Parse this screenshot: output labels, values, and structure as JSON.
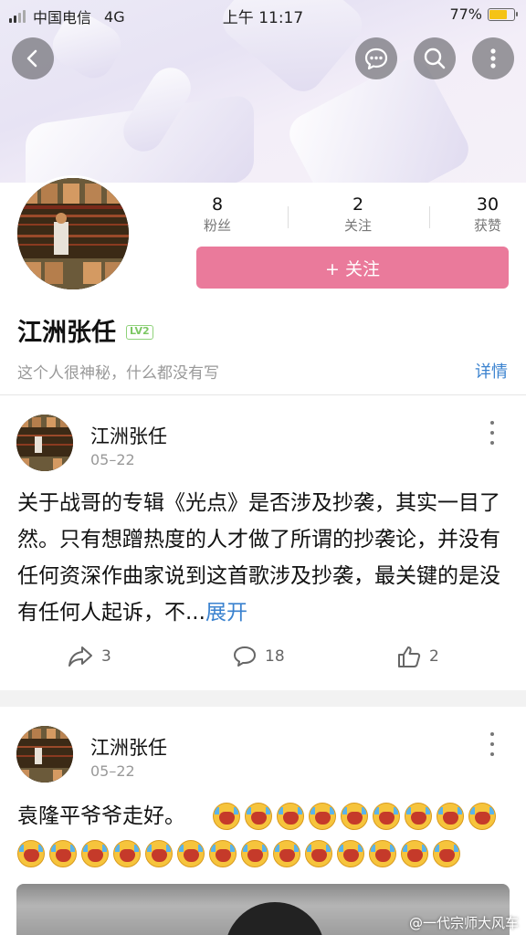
{
  "status_bar": {
    "carrier": "中国电信",
    "network": "4G",
    "time": "上午 11:17",
    "battery_text": "77%",
    "battery_level": 0.77
  },
  "header": {
    "back_icon": "chevron-left-icon",
    "chat_icon": "chat-bubble-icon",
    "search_icon": "search-icon",
    "more_icon": "more-vertical-icon"
  },
  "profile": {
    "stats": [
      {
        "value": "8",
        "label": "粉丝"
      },
      {
        "value": "2",
        "label": "关注"
      },
      {
        "value": "30",
        "label": "获赞"
      }
    ],
    "follow_label": "+ 关注",
    "name": "江洲张任",
    "level": "LV2",
    "bio": "这个人很神秘，什么都没有写",
    "detail_label": "详情"
  },
  "posts": [
    {
      "author": "江洲张任",
      "date": "05–22",
      "text": "关于战哥的专辑《光点》是否涉及抄袭，其实一目了然。只有想蹭热度的人才做了所谓的抄袭论，并没有任何资深作曲家说到这首歌涉及抄袭，最关键的是没有任何人起诉，不...",
      "expand_label": "展开",
      "share_count": "3",
      "comment_count": "18",
      "like_count": "2"
    },
    {
      "author": "江洲张任",
      "date": "05–22",
      "text": "袁隆平爷爷走好。",
      "emoji_name": "crying-emoji"
    }
  ],
  "watermark": "@一代宗师大风车",
  "colors": {
    "follow_button": "#ea7a9b",
    "link": "#3a82cf",
    "level_badge": "#7cc763",
    "battery": "#f5c316"
  }
}
